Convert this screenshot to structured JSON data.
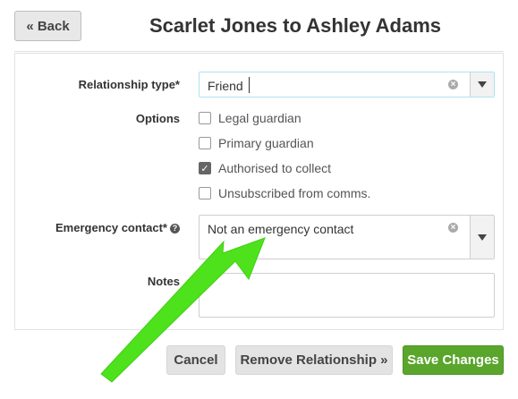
{
  "header": {
    "back_label": "« Back",
    "title": "Scarlet Jones to Ashley Adams"
  },
  "form": {
    "relationship_type": {
      "label": "Relationship type*",
      "value": "Friend"
    },
    "options": {
      "label": "Options",
      "items": [
        {
          "label": "Legal guardian",
          "checked": false
        },
        {
          "label": "Primary guardian",
          "checked": false
        },
        {
          "label": "Authorised to collect",
          "checked": true
        },
        {
          "label": "Unsubscribed from comms.",
          "checked": false
        }
      ]
    },
    "emergency_contact": {
      "label": "Emergency contact*",
      "value": "Not an emergency contact",
      "help_icon": "question-circle-icon"
    },
    "notes": {
      "label": "Notes",
      "value": ""
    }
  },
  "actions": {
    "cancel_label": "Cancel",
    "remove_label": "Remove Relationship »",
    "save_label": "Save Changes"
  },
  "colors": {
    "save_button": "#5aa52b",
    "annotation_arrow": "#4ee21c",
    "focus_border": "#aee3f0"
  }
}
